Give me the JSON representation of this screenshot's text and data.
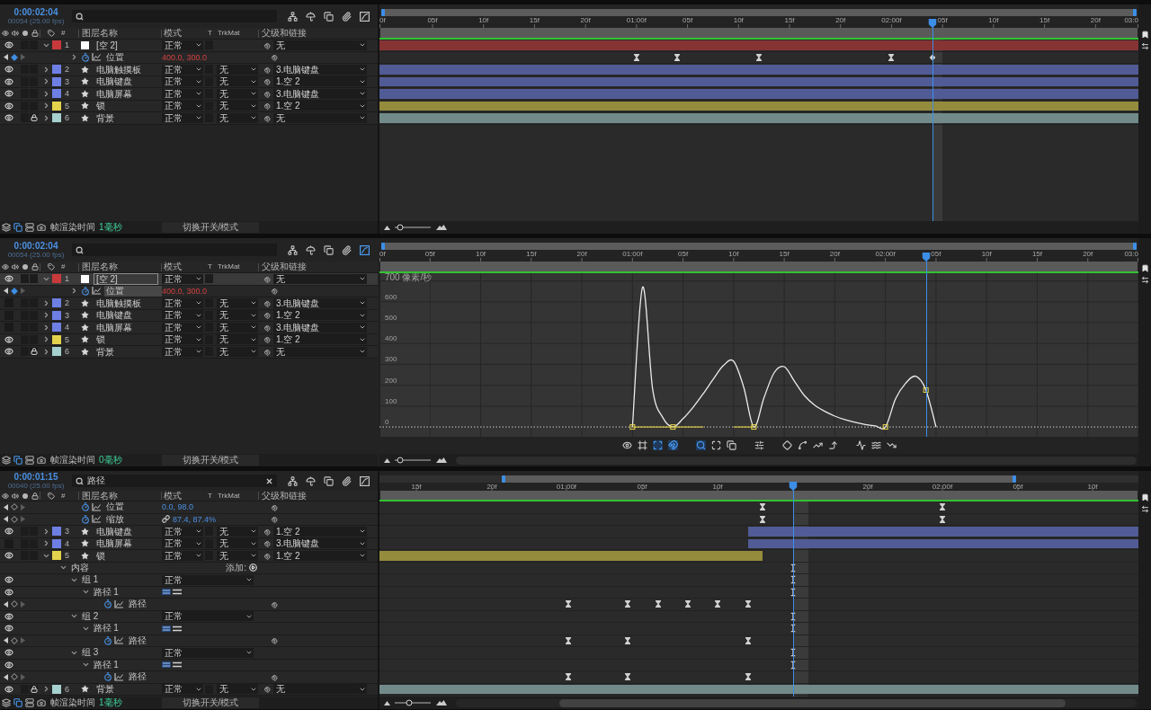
{
  "panels": [
    {
      "current_time": "0:00:02:04",
      "frame_info": "00054 (25.00 fps)",
      "toolbar": [
        {
          "selected": false
        },
        {
          "selected": false
        },
        {
          "selected": false
        },
        {
          "selected": false
        },
        {
          "selected": false
        }
      ],
      "columns": [
        "#",
        "图层名称",
        "模式",
        "T",
        "TrkMat",
        "父级和链接"
      ],
      "navigator": {
        "kind": "full"
      },
      "ruler": [
        {
          "label": "0f",
          "level": 0
        },
        {
          "label": "05f",
          "level": 0.0699
        },
        {
          "label": "10f",
          "level": 0.1371
        },
        {
          "label": "15f",
          "level": 0.2043
        },
        {
          "label": "20f",
          "level": 0.2715
        },
        {
          "label": "01:00f",
          "level": 0.3387
        },
        {
          "label": "05f",
          "level": 0.4059
        },
        {
          "label": "10f",
          "level": 0.4731
        },
        {
          "label": "15f",
          "level": 0.5403
        },
        {
          "label": "20f",
          "level": 0.6075
        },
        {
          "label": "02:00f",
          "level": 0.6747
        },
        {
          "label": "05f",
          "level": 0.7419
        },
        {
          "label": "10f",
          "level": 0.8091
        },
        {
          "label": "15f",
          "level": 0.8763
        },
        {
          "label": "20f",
          "level": 0.9435
        },
        {
          "label": "03:0",
          "level": 1
        }
      ],
      "playhead": {
        "level": 0.7285
      },
      "rows": [
        {
          "kind": "layer",
          "number": "1",
          "color": "#c8393b",
          "source": {
            "kind": "null"
          },
          "name": "[空 2]",
          "mode": "正常",
          "parent": "无",
          "visible": true,
          "locked": false,
          "expanded": true,
          "selected": false,
          "children": [
            {
              "kind": "property",
              "name": "位置",
              "value": "400.0, 300.0",
              "expression": true,
              "at_keyframe": true,
              "expanded": false,
              "selected": false,
              "keyframes": [
                {
                  "kind": "ease",
                  "level": 0.3387
                },
                {
                  "kind": "ease",
                  "level": 0.3925
                },
                {
                  "kind": "ease",
                  "level": 0.5
                },
                {
                  "kind": "ease",
                  "level": 0.6747
                },
                {
                  "kind": "linear",
                  "level": 0.7285
                }
              ]
            }
          ]
        },
        {
          "kind": "layer",
          "number": "2",
          "color": "#6e7fe3",
          "source": {
            "kind": "shape"
          },
          "name": "电脑触摸板",
          "mode": "正常",
          "trkmat": "无",
          "parent": "3.电脑键盘",
          "visible": true,
          "locked": false,
          "expanded": false,
          "selected": false
        },
        {
          "kind": "layer",
          "number": "3",
          "color": "#6e7fe3",
          "source": {
            "kind": "shape"
          },
          "name": "电脑键盘",
          "mode": "正常",
          "trkmat": "无",
          "parent": "1.空 2",
          "visible": true,
          "locked": false,
          "expanded": false,
          "selected": false
        },
        {
          "kind": "layer",
          "number": "4",
          "color": "#6e7fe3",
          "source": {
            "kind": "shape"
          },
          "name": "电脑屏幕",
          "mode": "正常",
          "trkmat": "无",
          "parent": "3.电脑键盘",
          "visible": true,
          "locked": false,
          "expanded": false,
          "selected": false
        },
        {
          "kind": "layer",
          "number": "5",
          "color": "#e3d24b",
          "source": {
            "kind": "shape"
          },
          "name": "锁",
          "mode": "正常",
          "trkmat": "无",
          "parent": "1.空 2",
          "visible": true,
          "locked": false,
          "expanded": false,
          "selected": false
        },
        {
          "kind": "layer",
          "number": "6",
          "color": "#a6d1cf",
          "source": {
            "kind": "shape"
          },
          "name": "背景",
          "mode": "正常",
          "trkmat": "无",
          "parent": "无",
          "visible": true,
          "locked": true,
          "expanded": false,
          "selected": false
        }
      ],
      "footer": {
        "buttons": [
          {
            "selected": false
          },
          {
            "selected": true
          },
          {
            "selected": false
          },
          {
            "selected": false
          }
        ],
        "label": "帧渲染时间",
        "value": "1毫秒",
        "toggle": "切换开关/模式",
        "zoom": {
          "level": 0.15
        }
      }
    },
    {
      "current_time": "0:00:02:04",
      "frame_info": "00054 (25.00 fps)",
      "toolbar": [
        {
          "selected": false
        },
        {
          "selected": false
        },
        {
          "selected": false
        },
        {
          "selected": false
        },
        {
          "selected": true
        }
      ],
      "columns": [
        "#",
        "图层名称",
        "模式",
        "T",
        "TrkMat",
        "父级和链接"
      ],
      "navigator": {
        "kind": "full"
      },
      "playhead": {
        "level": 0.72
      },
      "rows": [
        {
          "kind": "layer",
          "number": "1",
          "color": "#c8393b",
          "source": {
            "kind": "null"
          },
          "name": "[空 2]",
          "mode": "正常",
          "parent": "无",
          "visible": true,
          "locked": false,
          "expanded": true,
          "selected": true,
          "children": [
            {
              "kind": "property",
              "name": "位置",
              "value": "400.0, 300.0",
              "expression": true,
              "at_keyframe": true,
              "expanded": false,
              "selected": true
            }
          ]
        },
        {
          "kind": "layer",
          "number": "2",
          "color": "#6e7fe3",
          "source": {
            "kind": "shape"
          },
          "name": "电脑触摸板",
          "mode": "正常",
          "trkmat": "无",
          "parent": "3.电脑键盘",
          "visible": false,
          "locked": false,
          "expanded": false,
          "selected": false
        },
        {
          "kind": "layer",
          "number": "3",
          "color": "#6e7fe3",
          "source": {
            "kind": "shape"
          },
          "name": "电脑键盘",
          "mode": "正常",
          "trkmat": "无",
          "parent": "1.空 2",
          "visible": false,
          "locked": false,
          "expanded": false,
          "selected": false
        },
        {
          "kind": "layer",
          "number": "4",
          "color": "#6e7fe3",
          "source": {
            "kind": "shape"
          },
          "name": "电脑屏幕",
          "mode": "正常",
          "trkmat": "无",
          "parent": "3.电脑键盘",
          "visible": false,
          "locked": false,
          "expanded": false,
          "selected": false
        },
        {
          "kind": "layer",
          "number": "5",
          "color": "#e3d24b",
          "source": {
            "kind": "shape"
          },
          "name": "锁",
          "mode": "正常",
          "trkmat": "无",
          "parent": "1.空 2",
          "visible": true,
          "locked": false,
          "expanded": false,
          "selected": false
        },
        {
          "kind": "layer",
          "number": "6",
          "color": "#a6d1cf",
          "source": {
            "kind": "shape"
          },
          "name": "背景",
          "mode": "正常",
          "trkmat": "无",
          "parent": "无",
          "visible": true,
          "locked": true,
          "expanded": false,
          "selected": false
        }
      ],
      "graph": {
        "chart_data": {
          "type": "line",
          "grid": true,
          "ylim": [
            -47,
            737
          ],
          "categories": [
            "0f",
            null,
            null,
            null,
            null,
            "05f",
            null,
            null,
            null,
            null,
            "10f",
            null,
            null,
            null,
            null,
            "15f",
            null,
            null,
            null,
            null,
            "20f",
            null,
            null,
            null,
            null,
            "01:00f",
            null,
            null,
            null,
            null,
            "05f",
            null,
            null,
            null,
            null,
            "10f",
            null,
            null,
            null,
            null,
            "15f",
            null,
            null,
            null,
            null,
            "20f",
            null,
            null,
            null,
            null,
            "02:00f",
            null,
            null,
            null,
            null,
            "05f",
            null,
            null,
            null,
            null,
            "10f",
            null,
            null,
            null,
            null,
            "15f",
            null,
            null,
            null,
            null,
            "20f",
            null,
            null,
            null,
            null,
            "03:0"
          ],
          "yticks": [
            0,
            100,
            200,
            300,
            400,
            500,
            600,
            {
              "value": 700,
              "label": "700 像素/秒"
            }
          ],
          "ref_lines": [
            {
              "axis": "y",
              "value": 0,
              "color": "#d8d8d8",
              "line_style": "dotted"
            }
          ],
          "series": [
            {
              "type": "line",
              "color": "#ececec",
              "values": [
                null,
                null,
                null,
                null,
                null,
                null,
                null,
                null,
                null,
                null,
                null,
                null,
                null,
                null,
                null,
                null,
                null,
                null,
                null,
                null,
                null,
                null,
                null,
                null,
                null,
                0,
                670,
                180,
                45,
                0,
                40,
                95,
                160,
                230,
                295,
                315,
                190,
                0,
                140,
                260,
                289,
                220,
                150,
                105,
                75,
                52,
                35,
                22,
                12,
                5,
                0,
                135,
                210,
                243,
                177,
                0,
                null,
                null,
                null,
                null,
                null,
                null,
                null,
                null,
                null,
                null,
                null,
                null,
                null,
                null,
                null,
                null,
                null,
                null,
                null,
                null
              ]
            },
            {
              "type": "line",
              "color": "#d4c247",
              "values": [
                null,
                null,
                null,
                null,
                null,
                null,
                null,
                null,
                null,
                null,
                null,
                null,
                null,
                null,
                null,
                null,
                null,
                null,
                null,
                null,
                null,
                null,
                null,
                null,
                null,
                0,
                0,
                0,
                0,
                0,
                0,
                0,
                0,
                null,
                null,
                0,
                0,
                0,
                null,
                null,
                null,
                null,
                null,
                null,
                null,
                null,
                null,
                null,
                null,
                null,
                null,
                null,
                null,
                null,
                null,
                null,
                null,
                null,
                null,
                null,
                null,
                null,
                null,
                null,
                null,
                null,
                null,
                null,
                null,
                null,
                null,
                null,
                null,
                null,
                null,
                null
              ]
            },
            {
              "type": "scatter",
              "color": "#e8d44d",
              "marker": "square",
              "values": [
                null,
                null,
                null,
                null,
                null,
                null,
                null,
                null,
                null,
                null,
                null,
                null,
                null,
                null,
                null,
                null,
                null,
                null,
                null,
                null,
                null,
                null,
                null,
                null,
                null,
                0,
                null,
                null,
                null,
                0,
                null,
                null,
                null,
                null,
                null,
                null,
                null,
                0,
                null,
                null,
                null,
                null,
                null,
                null,
                null,
                null,
                null,
                null,
                null,
                null,
                0,
                null,
                null,
                null,
                177,
                null,
                null,
                null,
                null,
                null,
                null,
                null,
                null,
                null,
                null,
                null,
                null,
                null,
                null,
                null,
                null,
                null,
                null,
                null,
                null,
                null
              ]
            }
          ]
        },
        "toolbar": [
          {
            "selected": false
          },
          {
            "selected": false
          },
          {
            "selected": true
          },
          {
            "selected": true
          },
          {
            "selected": true
          },
          {
            "selected": false
          },
          {
            "selected": false
          },
          {
            "selected": false
          },
          {
            "selected": false
          },
          {
            "selected": false
          },
          {
            "selected": false
          },
          {
            "selected": false
          },
          {
            "selected": false
          },
          {
            "selected": false
          },
          {
            "selected": false
          }
        ]
      },
      "footer": {
        "buttons": [
          {
            "selected": false
          },
          {
            "selected": true
          },
          {
            "selected": false
          },
          {
            "selected": false
          }
        ],
        "label": "帧渲染时间",
        "value": "0毫秒",
        "toggle": "切换开关/模式",
        "zoom": {
          "level": 0.15
        },
        "scrollbar": {
          "kind": "full"
        }
      }
    },
    {
      "current_time": "0:00:01:15",
      "frame_info": "00040 (25.00 fps)",
      "search": {
        "value": "路径"
      },
      "toolbar": [
        {
          "selected": false
        },
        {
          "selected": false
        },
        {
          "selected": false
        },
        {
          "selected": false
        },
        {
          "selected": false
        }
      ],
      "columns": [
        "#",
        "图层名称",
        "模式",
        "T",
        "TrkMat",
        "父级和链接"
      ],
      "navigator": {
        "kind": "partial"
      },
      "ruler": [
        {
          "label": "15f",
          "level": 0.0486
        },
        {
          "label": "20f",
          "level": 0.1481
        },
        {
          "label": "01:00f",
          "level": 0.2464
        },
        {
          "label": "05f",
          "level": 0.346
        },
        {
          "label": "10f",
          "level": 0.4455
        },
        {
          "label": "20f",
          "level": 0.6434
        },
        {
          "label": "02:00f",
          "level": 0.7417
        },
        {
          "label": "05f",
          "level": 0.8412
        },
        {
          "label": "10f",
          "level": 0.9396
        }
      ],
      "playhead": {
        "level": 0.545
      },
      "rows": [
        {
          "kind": "property",
          "name": "位置",
          "value": "0.0, 98.0",
          "expression": false,
          "at_keyframe": false,
          "selected": false,
          "keyframes": [
            {
              "kind": "ease",
              "level": 0.5047
            },
            {
              "kind": "ease",
              "level": 0.7417
            }
          ]
        },
        {
          "kind": "property",
          "name": "缩放",
          "value": "87.4, 87.4%",
          "linked": true,
          "expression": false,
          "at_keyframe": false,
          "selected": false,
          "keyframes": [
            {
              "kind": "ease",
              "level": 0.5047
            },
            {
              "kind": "ease",
              "level": 0.7417
            }
          ]
        },
        {
          "kind": "layer",
          "number": "3",
          "color": "#6e7fe3",
          "source": {
            "kind": "shape"
          },
          "name": "电脑键盘",
          "mode": "正常",
          "trkmat": "无",
          "parent": "1.空 2",
          "visible": true,
          "locked": false,
          "expanded": false,
          "selected": false,
          "in_point": {
            "level": 0.4858
          }
        },
        {
          "kind": "layer",
          "number": "4",
          "color": "#6e7fe3",
          "source": {
            "kind": "shape"
          },
          "name": "电脑屏幕",
          "mode": "正常",
          "trkmat": "无",
          "parent": "3.电脑键盘",
          "visible": false,
          "locked": false,
          "expanded": false,
          "selected": false,
          "in_point": {
            "level": 0.4858
          }
        },
        {
          "kind": "layer",
          "number": "5",
          "color": "#e3d24b",
          "source": {
            "kind": "shape"
          },
          "name": "锁",
          "mode": "正常",
          "trkmat": "无",
          "parent": "1.空 2",
          "visible": true,
          "locked": false,
          "expanded": true,
          "selected": false,
          "out_point": {
            "level": 0.5047
          },
          "children": [
            {
              "kind": "contents",
              "name": "内容",
              "add_label": "添加:",
              "expanded": true,
              "selected": false,
              "keyframes": [
                {
                  "kind": "summary",
                  "level": 0.545
                }
              ],
              "children": [
                {
                  "kind": "group",
                  "name": "组 1",
                  "mode": "正常",
                  "visible": true,
                  "expanded": true,
                  "selected": false,
                  "keyframes": [
                    {
                      "kind": "summary",
                      "level": 0.545
                    }
                  ],
                  "children": [
                    {
                      "kind": "path",
                      "name": "路径 1",
                      "visible": true,
                      "expanded": true,
                      "selected": false,
                      "keyframes": [
                        {
                          "kind": "summary",
                          "level": 0.545
                        }
                      ],
                      "children": [
                        {
                          "kind": "property",
                          "name": "路径",
                          "at_keyframe": false,
                          "selected": false,
                          "keyframes": [
                            {
                              "kind": "ease",
                              "level": 0.2488
                            },
                            {
                              "kind": "ease",
                              "level": 0.327
                            },
                            {
                              "kind": "ease",
                              "level": 0.3673
                            },
                            {
                              "kind": "ease",
                              "level": 0.4064
                            },
                            {
                              "kind": "ease",
                              "level": 0.4455
                            },
                            {
                              "kind": "ease",
                              "level": 0.4858
                            }
                          ]
                        }
                      ]
                    }
                  ]
                },
                {
                  "kind": "group",
                  "name": "组 2",
                  "mode": "正常",
                  "visible": true,
                  "expanded": true,
                  "selected": false,
                  "keyframes": [
                    {
                      "kind": "summary",
                      "level": 0.545
                    }
                  ],
                  "children": [
                    {
                      "kind": "path",
                      "name": "路径 1",
                      "visible": true,
                      "expanded": true,
                      "selected": false,
                      "keyframes": [
                        {
                          "kind": "summary",
                          "level": 0.545
                        }
                      ],
                      "children": [
                        {
                          "kind": "property",
                          "name": "路径",
                          "at_keyframe": false,
                          "selected": false,
                          "keyframes": [
                            {
                              "kind": "ease",
                              "level": 0.2488
                            },
                            {
                              "kind": "ease",
                              "level": 0.327
                            },
                            {
                              "kind": "ease",
                              "level": 0.4858
                            }
                          ]
                        }
                      ]
                    }
                  ]
                },
                {
                  "kind": "group",
                  "name": "组 3",
                  "mode": "正常",
                  "visible": true,
                  "expanded": true,
                  "selected": false,
                  "keyframes": [
                    {
                      "kind": "summary",
                      "level": 0.545
                    }
                  ],
                  "children": [
                    {
                      "kind": "path",
                      "name": "路径 1",
                      "visible": true,
                      "expanded": true,
                      "selected": false,
                      "keyframes": [
                        {
                          "kind": "summary",
                          "level": 0.545
                        }
                      ],
                      "children": [
                        {
                          "kind": "property",
                          "name": "路径",
                          "at_keyframe": false,
                          "selected": false,
                          "keyframes": [
                            {
                              "kind": "ease",
                              "level": 0.2488
                            },
                            {
                              "kind": "ease",
                              "level": 0.327
                            },
                            {
                              "kind": "ease",
                              "level": 0.4858
                            }
                          ]
                        }
                      ]
                    }
                  ]
                }
              ]
            }
          ]
        },
        {
          "kind": "layer",
          "number": "6",
          "color": "#a6d1cf",
          "source": {
            "kind": "shape"
          },
          "name": "背景",
          "mode": "正常",
          "trkmat": "无",
          "parent": "无",
          "visible": true,
          "locked": true,
          "expanded": false,
          "selected": false
        }
      ],
      "footer": {
        "buttons": [
          {
            "selected": false
          },
          {
            "selected": true
          },
          {
            "selected": false
          },
          {
            "selected": false
          }
        ],
        "label": "帧渲染时间",
        "value": "1毫秒",
        "toggle": "切换开关/模式",
        "zoom": {
          "level": 0.4
        },
        "scrollbar": {
          "kind": "partial"
        }
      }
    }
  ]
}
